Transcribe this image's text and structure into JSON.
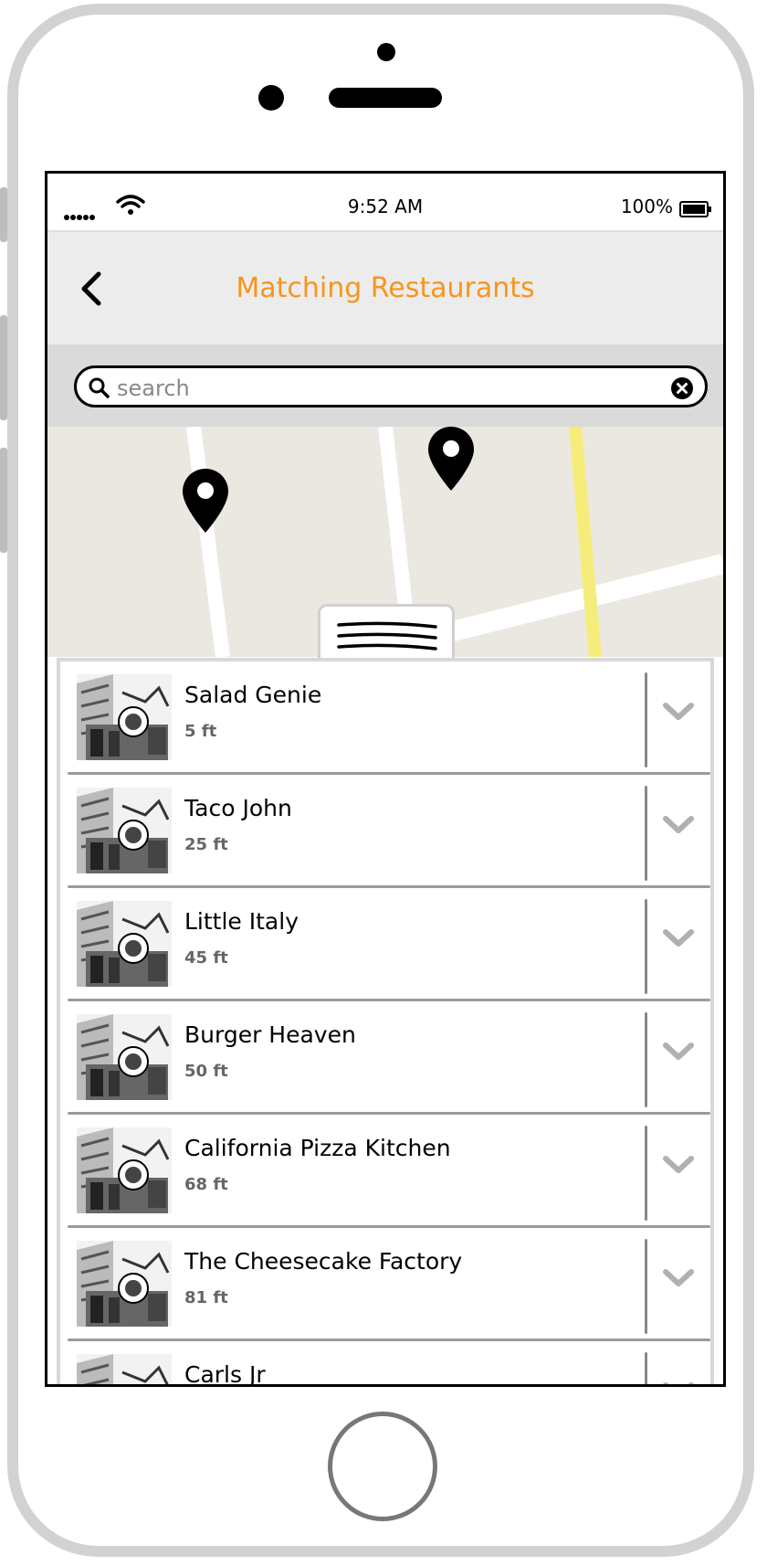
{
  "status_bar": {
    "time": "9:52 AM",
    "battery": "100%"
  },
  "nav": {
    "title": "Matching Restaurants"
  },
  "search": {
    "placeholder": "search"
  },
  "restaurants": [
    {
      "name": "Salad Genie",
      "distance": "5 ft"
    },
    {
      "name": "Taco John",
      "distance": "25 ft"
    },
    {
      "name": "Little Italy",
      "distance": "45 ft"
    },
    {
      "name": "Burger Heaven",
      "distance": "50 ft"
    },
    {
      "name": "California Pizza Kitchen",
      "distance": "68 ft"
    },
    {
      "name": "The Cheesecake Factory",
      "distance": "81 ft"
    },
    {
      "name": "Carls Jr",
      "distance": ""
    }
  ],
  "colors": {
    "accent": "#f7951d",
    "navbar": "#ececec",
    "searchbar": "#dadada",
    "map": "#ebe8e2",
    "highway": "#f6ec7a"
  }
}
